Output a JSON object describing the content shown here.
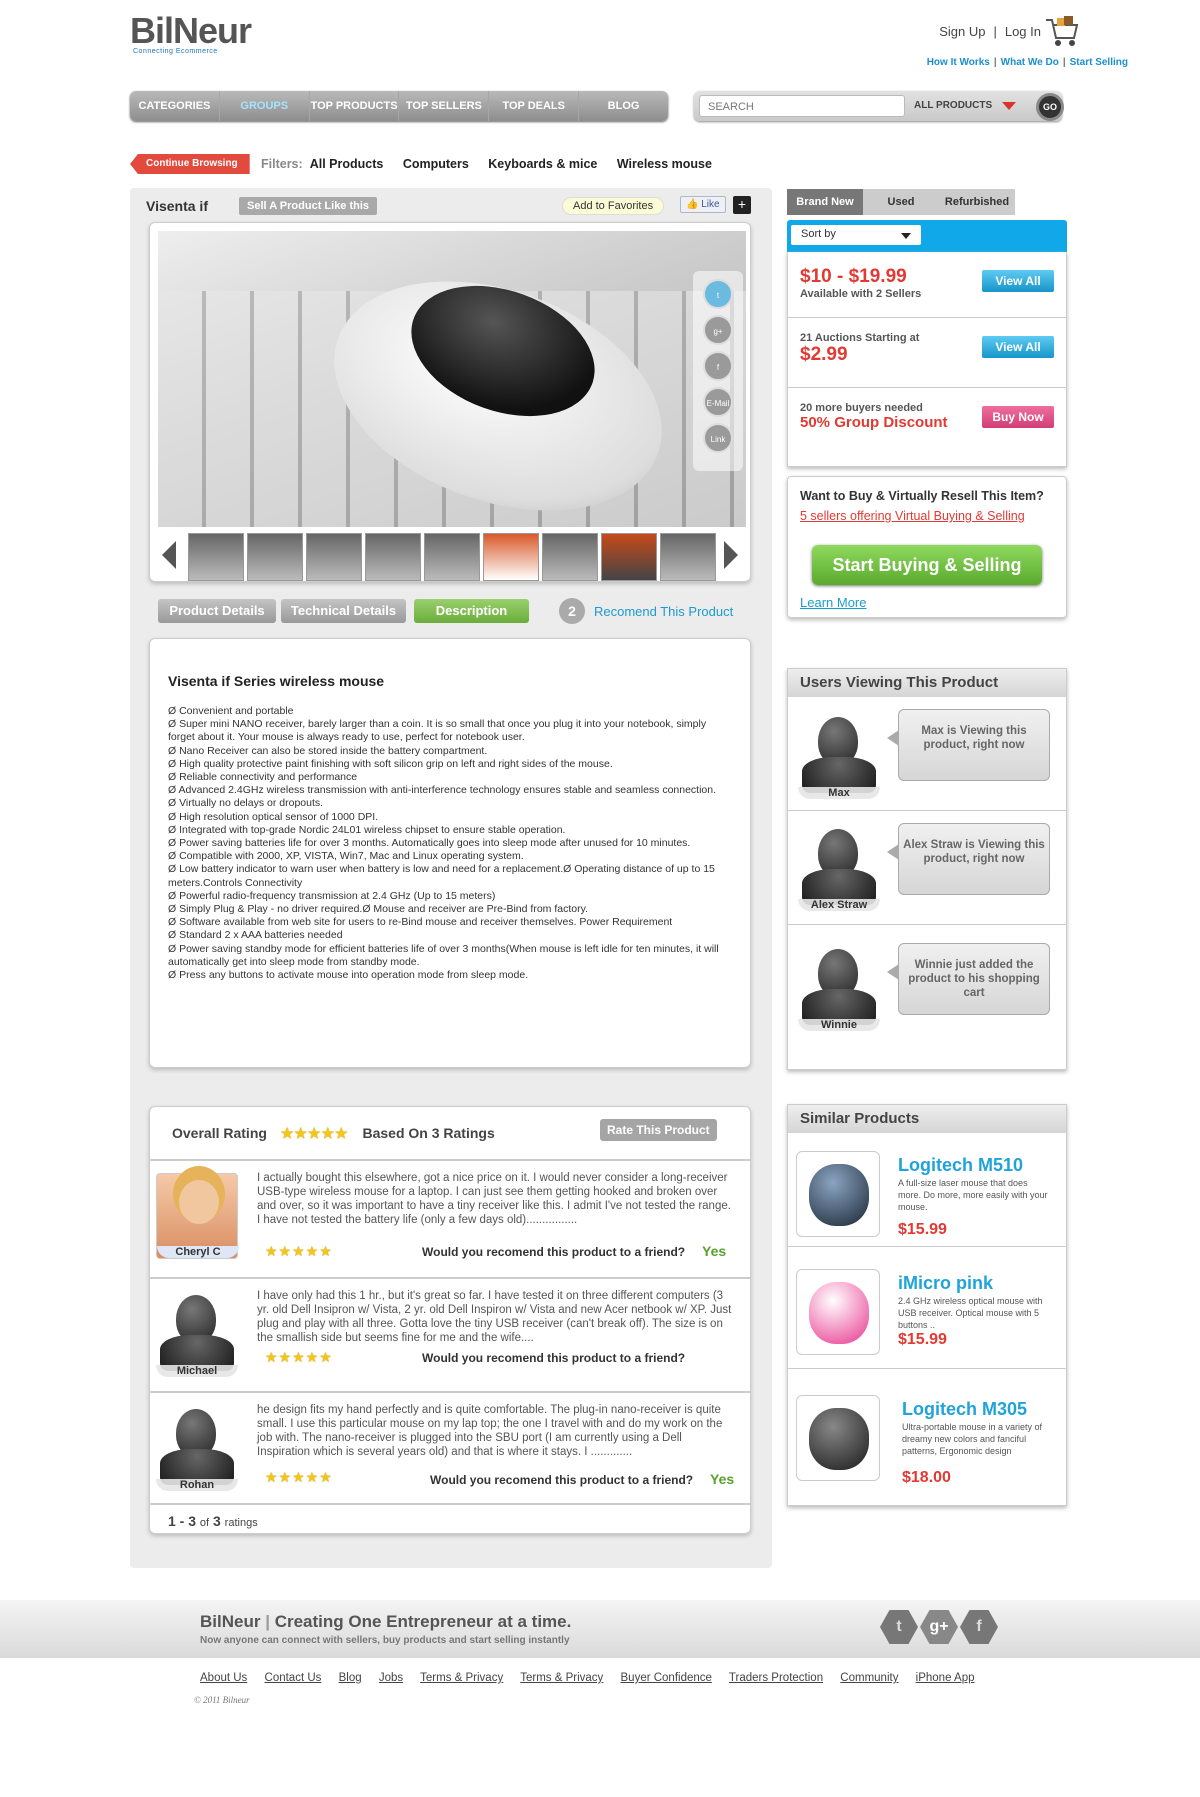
{
  "brand": {
    "name": "BilNeur",
    "tagline": "Connecting Ecommerce"
  },
  "header": {
    "signup": "Sign Up",
    "sep": "|",
    "login": "Log In",
    "sublinks": [
      "How It Works",
      "What We Do",
      "Start Selling"
    ]
  },
  "nav": {
    "items": [
      "CATEGORIES",
      "GROUPS",
      "TOP PRODUCTS",
      "TOP SELLERS",
      "TOP DEALS",
      "BLOG"
    ],
    "active": "GROUPS"
  },
  "search": {
    "placeholder": "SEARCH",
    "scope": "ALL PRODUCTS",
    "go": "GO"
  },
  "filters": {
    "continue": "Continue Browsing",
    "label": "Filters:",
    "items": [
      "All Products",
      "Computers",
      "Keyboards & mice",
      "Wireless mouse"
    ]
  },
  "product": {
    "title": "Visenta if",
    "sell_like": "Sell A Product Like this",
    "add_fav": "Add to Favorites",
    "like": "Like",
    "plus": "+",
    "social": [
      "E-Mail",
      "Link"
    ]
  },
  "tabs": {
    "details": "Product Details",
    "technical": "Technical Details",
    "description": "Description",
    "recommend_count": "2",
    "recommend": "Recomend This Product"
  },
  "description": {
    "title": "Visenta if Series wireless mouse",
    "bullets": [
      "Ø      Convenient and portable",
      "Ø      Super mini NANO receiver, barely larger than a coin. It is so small that once you plug it into your notebook, simply forget about it. Your mouse is always ready to use, perfect for notebook user.",
      "Ø      Nano Receiver can also be stored inside the battery compartment.",
      "Ø      High quality protective paint finishing with soft silicon grip on left and right sides of the mouse.",
      "Ø      Reliable connectivity and performance",
      "Ø      Advanced 2.4GHz wireless transmission with anti-interference technology ensures stable and seamless connection.",
      "Ø      Virtually no delays or dropouts.",
      "Ø      High resolution optical sensor of 1000 DPI.",
      "Ø      Integrated with top-grade Nordic 24L01 wireless chipset to ensure stable operation.",
      "Ø      Power saving batteries life for over 3 months. Automatically goes into sleep mode after unused for 10 minutes.",
      "Ø      Compatible with 2000, XP, VISTA, Win7, Mac and Linux operating system.",
      "Ø      Low battery indicator to warn user when battery is low and need for a replacement.Ø      Operating distance of up to 15 meters.Controls Connectivity",
      "Ø      Powerful radio-frequency transmission at 2.4 GHz (Up to 15 meters)",
      "Ø      Simply Plug & Play - no driver required.Ø      Mouse and receiver are Pre-Bind from factory.",
      "Ø      Software available from web site for users to re-Bind mouse and receiver themselves. Power Requirement",
      "Ø      Standard 2 x AAA batteries needed",
      "Ø      Power saving standby mode for efficient batteries life of over 3 months(When mouse is left idle for ten minutes, it will automatically get into sleep mode from standby mode.",
      "Ø      Press any buttons to activate mouse into operation mode from sleep mode."
    ]
  },
  "ratings": {
    "overall": "Overall Rating",
    "stars": "★★★★★",
    "based": "Based On 3 Ratings",
    "rate_btn": "Rate This Product",
    "question": "Would you recomend this product to a friend?",
    "reviews": [
      {
        "name": "Cheryl C",
        "text": "I actually bought this elsewhere, got a nice price on it. I would never consider a long-receiver USB-type wireless mouse for a laptop. I can just see them getting hooked and broken over and over, so it was important to have a tiny receiver like this. I admit I've not tested the range. I have not tested the battery life (only a few days old)................",
        "answer": "Yes"
      },
      {
        "name": "Michael",
        "text": "I have only had this 1 hr., but it's great so far. I have tested it on three different computers (3 yr. old Dell Insipron w/ Vista, 2 yr. old Dell Inspiron w/ Vista and new Acer netbook w/ XP. Just plug and play with all three. Gotta love the tiny USB receiver (can't break off). The size is on the smallish side but seems fine for me and the wife....",
        "answer": ""
      },
      {
        "name": "Rohan",
        "text": "he design fits my hand perfectly and is quite comfortable. The plug-in nano-receiver is quite small. I use this particular mouse on my lap top; the one I travel with and do my work on the job with. The nano-receiver is plugged into the SBU port (I am currently using a Dell Inspiration which is several years old) and that is where it stays. I .............",
        "answer": "Yes"
      }
    ],
    "pager": {
      "range": "1 - 3",
      "of": "of",
      "total": "3",
      "label": "ratings"
    }
  },
  "condition_tabs": [
    "Brand New",
    "Used",
    "Refurbished"
  ],
  "sort": "Sort by",
  "offers": [
    {
      "big": "$10 - $19.99",
      "small": "Available with 2 Sellers",
      "btn": "View All"
    },
    {
      "small": "21 Auctions Starting at",
      "big": "$2.99",
      "btn": "View All"
    },
    {
      "small": "20 more buyers needed",
      "big": "50% Group Discount",
      "btn": "Buy Now"
    }
  ],
  "resell": {
    "question": "Want to Buy & Virtually Resell This Item?",
    "sellers": "5 sellers offering Virtual Buying & Selling",
    "btn": "Start Buying & Selling",
    "learn": "Learn More"
  },
  "viewers": {
    "title": "Users Viewing This Product",
    "items": [
      {
        "name": "Max",
        "msg": "Max is Viewing this product, right now"
      },
      {
        "name": "Alex Straw",
        "msg": "Alex Straw is Viewing this product, right now"
      },
      {
        "name": "Winnie",
        "msg": "Winnie just added the product to his shopping cart"
      }
    ]
  },
  "similar": {
    "title": "Similar Products",
    "items": [
      {
        "name": "Logitech M510",
        "desc": "A full-size laser mouse that does more. Do more, more easily with your mouse.",
        "price": "$15.99",
        "color": "#3d5a7a"
      },
      {
        "name": "iMicro pink",
        "desc": "2.4 GHz wireless optical mouse with USB receiver. Optical mouse with 5 buttons ..",
        "price": "$15.99",
        "color": "#e8358e"
      },
      {
        "name": "Logitech M305",
        "desc": "Ultra-portable mouse in a variety of dreamy new colors and fanciful patterns, Ergonomic design",
        "price": "$18.00",
        "color": "#333333"
      }
    ]
  },
  "footer": {
    "brand": "BilNeur",
    "sep": "|",
    "slogan": "Creating One Entrepreneur at a time.",
    "sub": "Now anyone can connect with sellers, buy products and start selling instantly",
    "links": [
      "About Us",
      "Contact Us",
      "Blog",
      "Jobs",
      "Terms & Privacy",
      "Terms & Privacy",
      "Buyer Confidence",
      "Traders Protection",
      "Community",
      "iPhone App"
    ],
    "copyright": "© 2011 Bilneur"
  },
  "colors": {
    "accent_blue": "#10a8e8",
    "price_red": "#e23a33",
    "green": "#6aad3b",
    "link_blue": "#1b9bd2"
  }
}
